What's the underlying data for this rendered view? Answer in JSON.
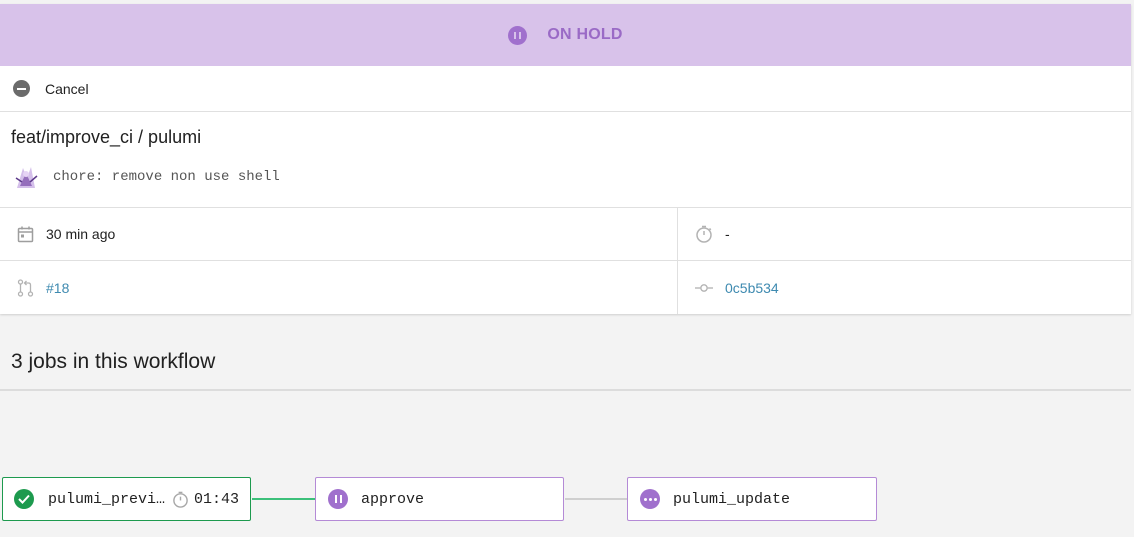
{
  "status": {
    "label": "ON HOLD",
    "icon": "pause-circle-icon",
    "color": "#a070cd"
  },
  "actions": {
    "cancel_label": "Cancel"
  },
  "workflow": {
    "branch_title": "feat/improve_ci / pulumi",
    "commit_message": "chore: remove non use shell"
  },
  "meta": {
    "started": "30 min ago",
    "duration": "-",
    "pr_number": "#18",
    "commit_sha": "0c5b534"
  },
  "jobs_section": {
    "heading": "3 jobs in this workflow",
    "jobs": [
      {
        "name": "pulumi_preview",
        "status": "success",
        "duration": "01:43"
      },
      {
        "name": "approve",
        "status": "on-hold"
      },
      {
        "name": "pulumi_update",
        "status": "queued"
      }
    ]
  },
  "colors": {
    "success": "#1d9a4e",
    "hold": "#a070cd",
    "link": "#3e8ab0"
  }
}
